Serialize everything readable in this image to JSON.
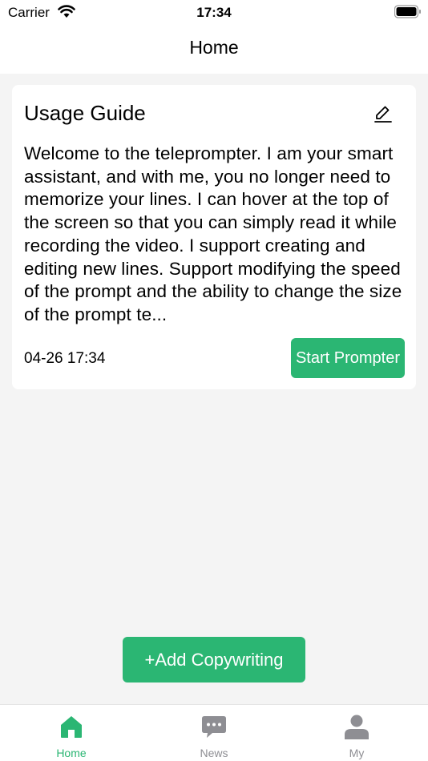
{
  "status_bar": {
    "carrier": "Carrier",
    "time": "17:34"
  },
  "nav": {
    "title": "Home"
  },
  "card": {
    "title": "Usage Guide",
    "body": "Welcome to the teleprompter. I am your smart assistant, and with me, you no longer need to memorize your lines. I can hover at the top of the screen so that you can simply read it while recording the video. I support creating and editing new lines. Support modifying the speed of the prompt and the ability to change the size of the prompt te...",
    "date": "04-26 17:34",
    "start_label": "Start Prompter",
    "edit_icon": "edit-icon"
  },
  "add_button": {
    "label": "+Add Copywriting"
  },
  "tabs": [
    {
      "label": "Home",
      "icon": "home-icon",
      "active": true
    },
    {
      "label": "News",
      "icon": "chat-bubble-icon",
      "active": false
    },
    {
      "label": "My",
      "icon": "person-icon",
      "active": false
    }
  ],
  "colors": {
    "accent": "#2bb673",
    "inactive": "#8e8e93",
    "background": "#f4f4f4"
  }
}
